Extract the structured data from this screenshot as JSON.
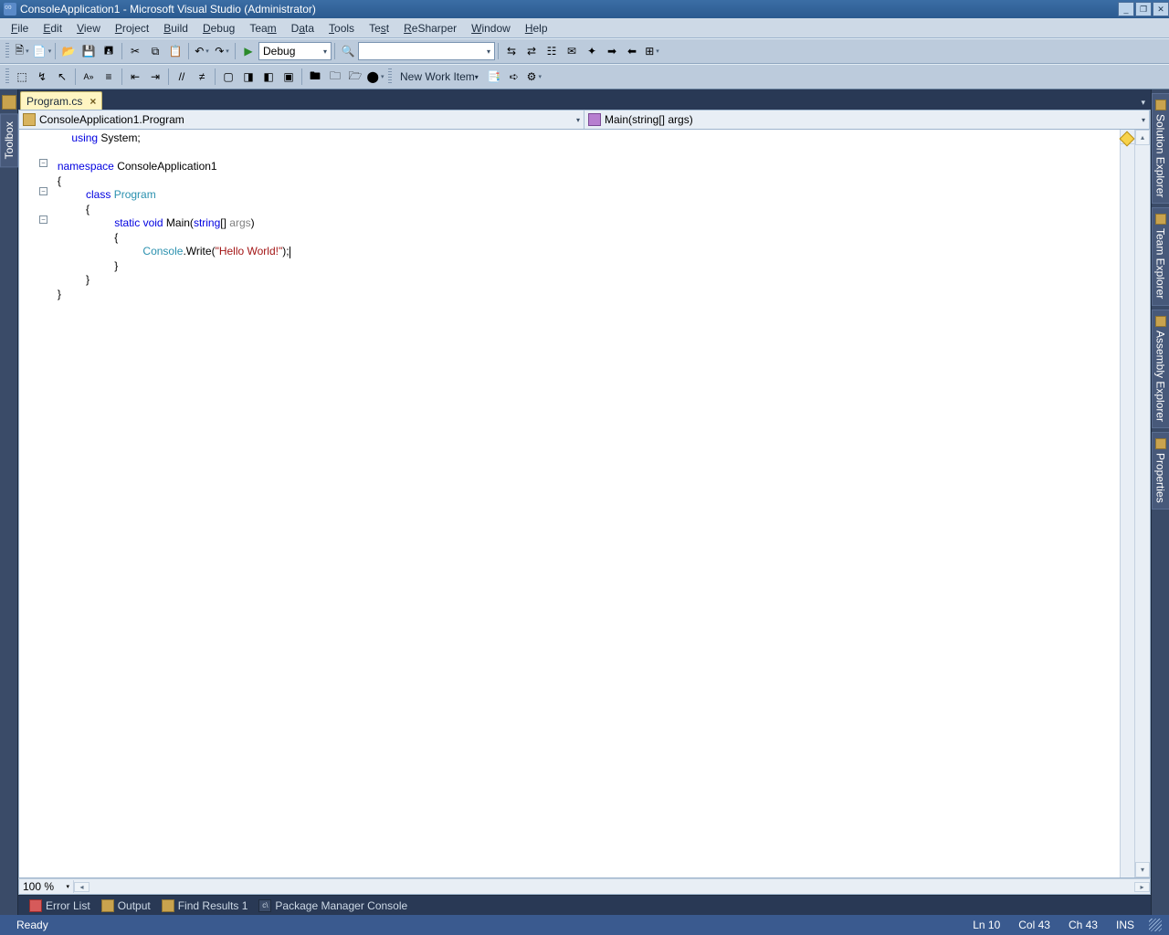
{
  "title": "ConsoleApplication1 - Microsoft Visual Studio (Administrator)",
  "menu": [
    "File",
    "Edit",
    "View",
    "Project",
    "Build",
    "Debug",
    "Team",
    "Data",
    "Tools",
    "Test",
    "ReSharper",
    "Window",
    "Help"
  ],
  "toolsDebug": "Debug",
  "newWorkItem": "New Work Item",
  "doc": {
    "tab": "Program.cs"
  },
  "nav": {
    "left": "ConsoleApplication1.Program",
    "right": "Main(string[] args)"
  },
  "code": {
    "l1_using": "using",
    "l1_system": " System;",
    "l3_ns": "namespace",
    "l3_name": " ConsoleApplication1",
    "l4": "{",
    "l5_cls": "class ",
    "l5_name": "Program",
    "l6": "{",
    "l7_static": "static ",
    "l7_void": "void ",
    "l7_main": "Main(",
    "l7_string": "string",
    "l7_br": "[] ",
    "l7_args": "args",
    "l7_end": ")",
    "l8": "{",
    "l9_console": "Console",
    "l9_write": ".Write(",
    "l9_str": "\"Hello World!\"",
    "l9_end": ");",
    "l10": "}",
    "l11": "}",
    "l12": "}"
  },
  "zoom": "100 %",
  "leftDock": "Toolbox",
  "rightDock": [
    "Solution Explorer",
    "Team Explorer",
    "Assembly Explorer",
    "Properties"
  ],
  "bottomTabs": [
    "Error List",
    "Output",
    "Find Results 1",
    "Package Manager Console"
  ],
  "status": {
    "ready": "Ready",
    "ln": "Ln 10",
    "col": "Col 43",
    "ch": "Ch 43",
    "ins": "INS"
  }
}
